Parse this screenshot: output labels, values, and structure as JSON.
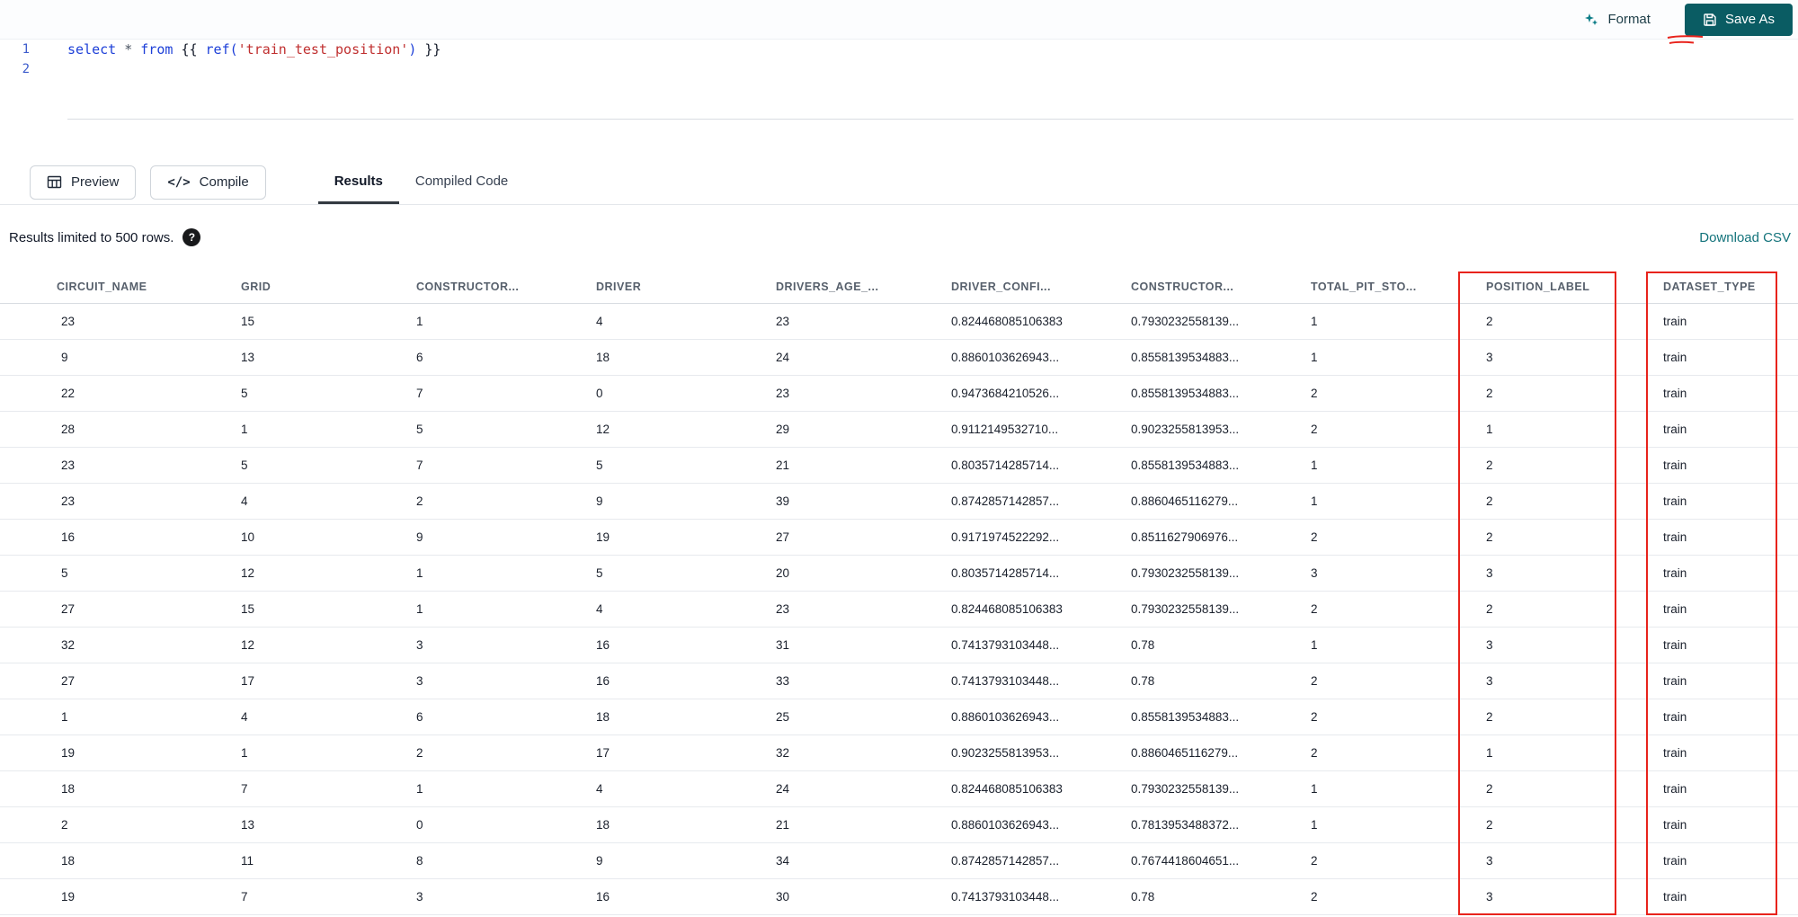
{
  "topbar": {
    "format_label": "Format",
    "save_as_label": "Save As"
  },
  "editor": {
    "line_numbers": [
      "1",
      "2"
    ],
    "code": {
      "kw_select": "select",
      "op_star": "*",
      "kw_from": "from",
      "jinja_open": "{{",
      "fn_ref": "ref(",
      "string": "'train_test_position'",
      "paren_close": ")",
      "jinja_close": "}}"
    }
  },
  "actionbar": {
    "preview_label": "Preview",
    "compile_label": "Compile",
    "compile_icon_glyph": "</>",
    "tabs": [
      {
        "label": "Results",
        "active": true
      },
      {
        "label": "Compiled Code",
        "active": false
      }
    ]
  },
  "results": {
    "limit_note": "Results limited to 500 rows.",
    "help_glyph": "?",
    "download_csv_label": "Download CSV"
  },
  "table": {
    "columns": [
      "CIRCUIT_NAME",
      "GRID",
      "CONSTRUCTOR...",
      "DRIVER",
      "DRIVERS_AGE_...",
      "DRIVER_CONFI...",
      "CONSTRUCTOR...",
      "TOTAL_PIT_STO...",
      "POSITION_LABEL",
      "DATASET_TYPE"
    ],
    "rows": [
      [
        "23",
        "15",
        "1",
        "4",
        "23",
        "0.824468085106383",
        "0.7930232558139...",
        "1",
        "2",
        "train"
      ],
      [
        "9",
        "13",
        "6",
        "18",
        "24",
        "0.8860103626943...",
        "0.8558139534883...",
        "1",
        "3",
        "train"
      ],
      [
        "22",
        "5",
        "7",
        "0",
        "23",
        "0.9473684210526...",
        "0.8558139534883...",
        "2",
        "2",
        "train"
      ],
      [
        "28",
        "1",
        "5",
        "12",
        "29",
        "0.9112149532710...",
        "0.9023255813953...",
        "2",
        "1",
        "train"
      ],
      [
        "23",
        "5",
        "7",
        "5",
        "21",
        "0.8035714285714...",
        "0.8558139534883...",
        "1",
        "2",
        "train"
      ],
      [
        "23",
        "4",
        "2",
        "9",
        "39",
        "0.8742857142857...",
        "0.8860465116279...",
        "1",
        "2",
        "train"
      ],
      [
        "16",
        "10",
        "9",
        "19",
        "27",
        "0.9171974522292...",
        "0.8511627906976...",
        "2",
        "2",
        "train"
      ],
      [
        "5",
        "12",
        "1",
        "5",
        "20",
        "0.8035714285714...",
        "0.7930232558139...",
        "3",
        "3",
        "train"
      ],
      [
        "27",
        "15",
        "1",
        "4",
        "23",
        "0.824468085106383",
        "0.7930232558139...",
        "2",
        "2",
        "train"
      ],
      [
        "32",
        "12",
        "3",
        "16",
        "31",
        "0.7413793103448...",
        "0.78",
        "1",
        "3",
        "train"
      ],
      [
        "27",
        "17",
        "3",
        "16",
        "33",
        "0.7413793103448...",
        "0.78",
        "2",
        "3",
        "train"
      ],
      [
        "1",
        "4",
        "6",
        "18",
        "25",
        "0.8860103626943...",
        "0.8558139534883...",
        "2",
        "2",
        "train"
      ],
      [
        "19",
        "1",
        "2",
        "17",
        "32",
        "0.9023255813953...",
        "0.8860465116279...",
        "2",
        "1",
        "train"
      ],
      [
        "18",
        "7",
        "1",
        "4",
        "24",
        "0.824468085106383",
        "0.7930232558139...",
        "1",
        "2",
        "train"
      ],
      [
        "2",
        "13",
        "0",
        "18",
        "21",
        "0.8860103626943...",
        "0.7813953488372...",
        "1",
        "2",
        "train"
      ],
      [
        "18",
        "11",
        "8",
        "9",
        "34",
        "0.8742857142857...",
        "0.7674418604651...",
        "2",
        "3",
        "train"
      ],
      [
        "19",
        "7",
        "3",
        "16",
        "30",
        "0.7413793103448...",
        "0.78",
        "2",
        "3",
        "train"
      ]
    ]
  },
  "annotations": {
    "box_color": "#e8231c",
    "highlighted_columns": [
      "POSITION_LABEL",
      "DATASET_TYPE"
    ]
  }
}
